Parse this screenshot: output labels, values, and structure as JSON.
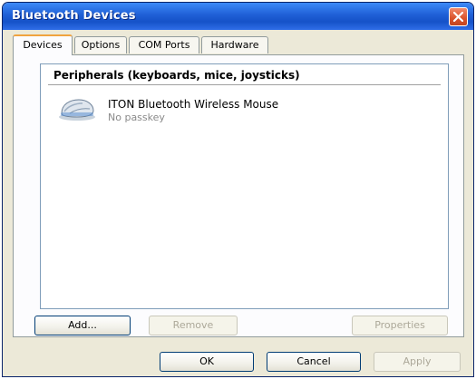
{
  "window": {
    "title": "Bluetooth Devices"
  },
  "tabs": [
    {
      "label": "Devices",
      "active": true
    },
    {
      "label": "Options",
      "active": false
    },
    {
      "label": "COM Ports",
      "active": false
    },
    {
      "label": "Hardware",
      "active": false
    }
  ],
  "devices_tab": {
    "group_header": "Peripherals (keyboards, mice, joysticks)",
    "devices": [
      {
        "name": "ITON Bluetooth Wireless Mouse",
        "status": "No passkey",
        "icon": "mouse-icon"
      }
    ],
    "buttons": {
      "add": "Add...",
      "remove": "Remove",
      "properties": "Properties"
    }
  },
  "dialog_buttons": {
    "ok": "OK",
    "cancel": "Cancel",
    "apply": "Apply"
  },
  "colors": {
    "titlebar": "#1f5fd6",
    "window_bg": "#ece9d8",
    "active_tab_accent": "#f0a33f",
    "close_button": "#d9532c"
  }
}
